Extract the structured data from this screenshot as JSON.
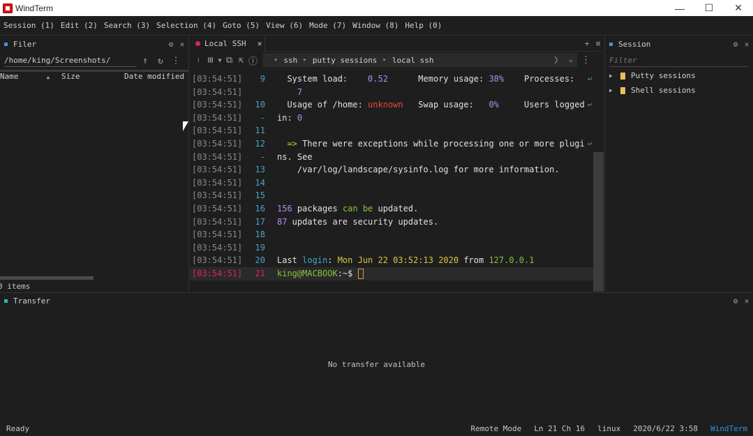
{
  "window": {
    "title": "WindTerm",
    "minimize": "—",
    "maximize": "☐",
    "close": "✕"
  },
  "menu": [
    "Session (1)",
    "Edit (2)",
    "Search (3)",
    "Selection (4)",
    "Goto (5)",
    "View (6)",
    "Mode (7)",
    "Window (8)",
    "Help (0)"
  ],
  "filer": {
    "title": "Filer",
    "path": "/home/king/Screenshots/",
    "columns": {
      "name": "Name",
      "sort_icon": "▲",
      "size": "Size",
      "date": "Date modified"
    },
    "items_count": "0 items",
    "accent": "#4a90d9"
  },
  "terminal": {
    "tab_label": "Local SSH",
    "tab_color": "#e0206a",
    "breadcrumb": [
      "ssh",
      "putty sessions",
      "local ssh"
    ],
    "lines": [
      {
        "ts": "[03:54:51]",
        "ln": "9",
        "wrap": true,
        "parts": [
          [
            "  System load:    ",
            ""
          ],
          [
            "0.52",
            "c-purple"
          ],
          [
            "      Memory usage: ",
            ""
          ],
          [
            "38%",
            "c-purple"
          ],
          [
            "    Processes:",
            ""
          ]
        ]
      },
      {
        "ts": "[03:54:51]",
        "ln": "",
        "parts": [
          [
            "    ",
            ""
          ],
          [
            "7",
            "c-purple"
          ]
        ]
      },
      {
        "ts": "[03:54:51]",
        "ln": "10",
        "wrap": true,
        "parts": [
          [
            "  Usage of /home: ",
            ""
          ],
          [
            "unknown",
            "c-red"
          ],
          [
            "   Swap usage:   ",
            ""
          ],
          [
            "0%",
            "c-purple"
          ],
          [
            "     Users logged",
            ""
          ]
        ]
      },
      {
        "ts": "[03:54:51]",
        "ln": "-",
        "parts": [
          [
            "in: ",
            ""
          ],
          [
            "0",
            "c-purple"
          ]
        ]
      },
      {
        "ts": "[03:54:51]",
        "ln": "11",
        "parts": []
      },
      {
        "ts": "[03:54:51]",
        "ln": "12",
        "wrap": true,
        "parts": [
          [
            "  ",
            ""
          ],
          [
            "=>",
            "c-yellow"
          ],
          [
            " There were exceptions while processing one or more plugi",
            ""
          ]
        ]
      },
      {
        "ts": "[03:54:51]",
        "ln": "-",
        "parts": [
          [
            "ns. See",
            ""
          ]
        ]
      },
      {
        "ts": "[03:54:51]",
        "ln": "13",
        "parts": [
          [
            "    /var/log/landscape/sysinfo.log for more information.",
            ""
          ]
        ]
      },
      {
        "ts": "[03:54:51]",
        "ln": "14",
        "parts": []
      },
      {
        "ts": "[03:54:51]",
        "ln": "15",
        "parts": []
      },
      {
        "ts": "[03:54:51]",
        "ln": "16",
        "parts": [
          [
            "156",
            "c-purple"
          ],
          [
            " packages ",
            ""
          ],
          [
            "can be",
            "c-green"
          ],
          [
            " updated.",
            ""
          ]
        ]
      },
      {
        "ts": "[03:54:51]",
        "ln": "17",
        "parts": [
          [
            "87",
            "c-purple"
          ],
          [
            " updates are security updates.",
            ""
          ]
        ]
      },
      {
        "ts": "[03:54:51]",
        "ln": "18",
        "parts": []
      },
      {
        "ts": "[03:54:51]",
        "ln": "19",
        "parts": []
      },
      {
        "ts": "[03:54:51]",
        "ln": "20",
        "parts": [
          [
            "Last ",
            ""
          ],
          [
            "login",
            "c-blue"
          ],
          [
            ": ",
            ""
          ],
          [
            "Mon Jun 22 03:52:13 2020",
            "c-yellow"
          ],
          [
            " from ",
            ""
          ],
          [
            "127.0.0.1",
            "c-green"
          ]
        ]
      },
      {
        "ts": "[03:54:51]",
        "ln": "21",
        "current": true,
        "parts": [
          [
            "king@MACBOOK",
            "c-green"
          ],
          [
            ":~$ ",
            ""
          ]
        ]
      }
    ]
  },
  "session": {
    "title": "Session",
    "filter_placeholder": "Filter",
    "items": [
      "Putty sessions",
      "Shell sessions"
    ]
  },
  "transfer": {
    "title": "Transfer",
    "empty_text": "No transfer available",
    "accent": "#20c0c0"
  },
  "status": {
    "ready": "Ready",
    "mode": "Remote Mode",
    "position": "Ln 21 Ch 16",
    "os": "linux",
    "datetime": "2020/6/22 3:58",
    "brand": "WindTerm"
  }
}
